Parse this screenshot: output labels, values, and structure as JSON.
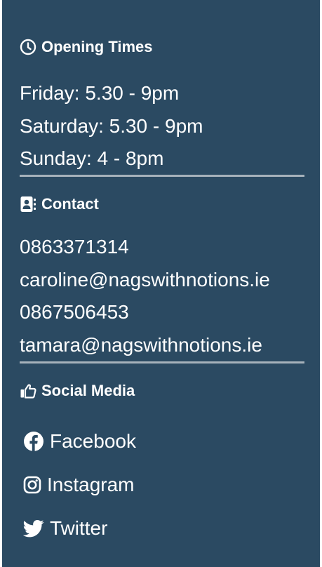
{
  "opening_times": {
    "heading": "Opening Times",
    "icon": "clock-icon",
    "lines": [
      "Friday: 5.30 - 9pm",
      "Saturday: 5.30 - 9pm",
      "Sunday: 4 - 8pm"
    ]
  },
  "contact": {
    "heading": "Contact",
    "icon": "address-book-icon",
    "lines": [
      "0863371314",
      "caroline@nagswithnotions.ie",
      "0867506453",
      "tamara@nagswithnotions.ie"
    ]
  },
  "social_media": {
    "heading": "Social Media",
    "icon": "thumbs-up-icon",
    "links": [
      {
        "label": "Facebook",
        "icon": "facebook-icon"
      },
      {
        "label": "Instagram",
        "icon": "instagram-icon"
      },
      {
        "label": "Twitter",
        "icon": "twitter-icon"
      }
    ]
  },
  "colors": {
    "panel_background": "#2b4a62",
    "text": "#ffffff",
    "divider": "#a7b2bb"
  }
}
